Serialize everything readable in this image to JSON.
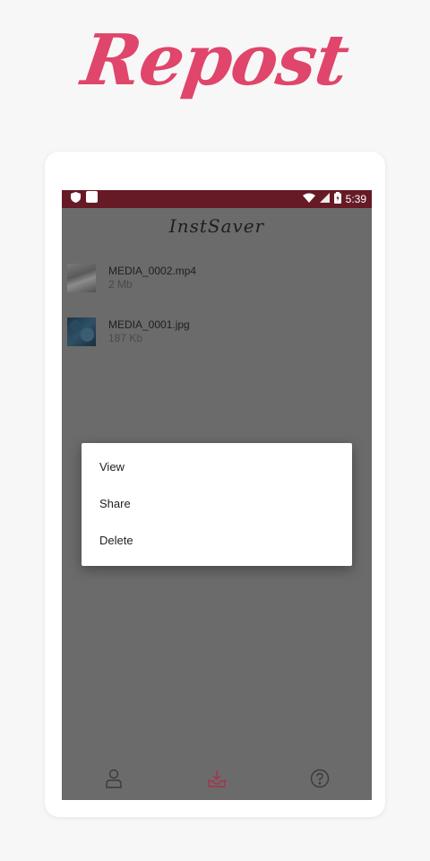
{
  "promo": {
    "title": "Repost"
  },
  "status_bar": {
    "time": "5:39"
  },
  "app": {
    "title": "InstSaver"
  },
  "files": [
    {
      "name": "MEDIA_0002.mp4",
      "size": "2 Mb",
      "type": "video"
    },
    {
      "name": "MEDIA_0001.jpg",
      "size": "187 Kb",
      "type": "image"
    }
  ],
  "context_menu": {
    "items": [
      {
        "label": "View"
      },
      {
        "label": "Share"
      },
      {
        "label": "Delete"
      }
    ]
  },
  "bottom_nav": {
    "items": [
      {
        "icon": "profile-icon",
        "active": false
      },
      {
        "icon": "download-tray-icon",
        "active": true
      },
      {
        "icon": "help-icon",
        "active": false
      }
    ]
  },
  "colors": {
    "accent": "#e0456b",
    "status_bar": "#661a26",
    "active_nav": "#a8324a",
    "inactive_nav": "#3a3a3a"
  }
}
